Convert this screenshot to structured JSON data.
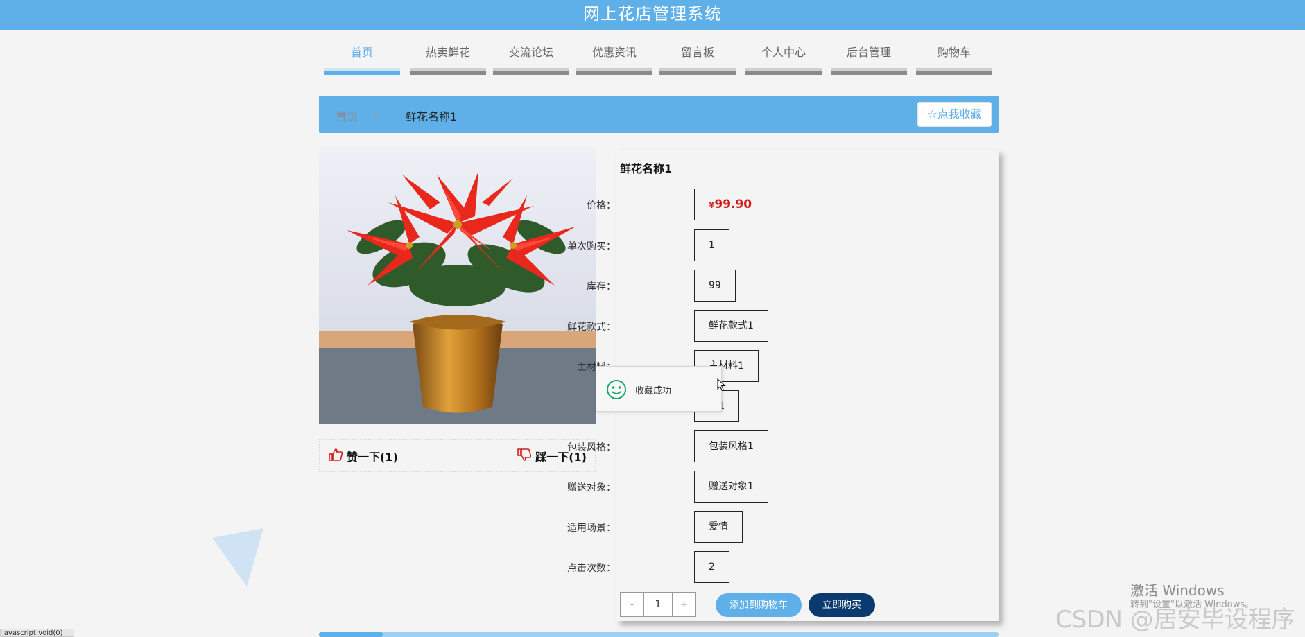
{
  "app": {
    "title": "网上花店管理系统"
  },
  "nav": [
    {
      "label": "首页",
      "active": true
    },
    {
      "label": "热卖鲜花"
    },
    {
      "label": "交流论坛"
    },
    {
      "label": "优惠资讯"
    },
    {
      "label": "留言板"
    },
    {
      "label": "个人中心"
    },
    {
      "label": "后台管理"
    },
    {
      "label": "购物车"
    }
  ],
  "breadcrumb": {
    "home": "首页",
    "separator": "/",
    "current": "鲜花名称1",
    "favorite_button": "☆点我收藏"
  },
  "product": {
    "name": "鲜花名称1",
    "price": {
      "label": "价格：",
      "currency": "¥",
      "value": "99.90"
    },
    "fields": [
      {
        "label": "单次购买：",
        "value": "1"
      },
      {
        "label": "库存：",
        "value": "99"
      },
      {
        "label": "鲜花款式：",
        "value": "鲜花款式1"
      },
      {
        "label": "主材料：",
        "value": "主材料1"
      },
      {
        "label": "",
        "value": "语1"
      },
      {
        "label": "包装风格：",
        "value": "包装风格1"
      },
      {
        "label": "赠送对象：",
        "value": "赠送对象1"
      },
      {
        "label": "适用场景：",
        "value": "爱情"
      },
      {
        "label": "点击次数：",
        "value": "2"
      }
    ]
  },
  "vote": {
    "like": "赞一下(1)",
    "dislike": "踩一下(1)"
  },
  "quantity": {
    "minus": "-",
    "value": "1",
    "plus": "+"
  },
  "actions": {
    "add_to_cart": "添加到购物车",
    "buy_now": "立即购买"
  },
  "toast": {
    "message": "收藏成功"
  },
  "status_bar": {
    "text": "javascript:void(0)"
  },
  "watermark": {
    "windows_title": "激活 Windows",
    "windows_sub": "转到\"设置\"以激活 Windows。",
    "csdn": "CSDN @居安毕设程序"
  },
  "colors": {
    "primary": "#5fb0e8",
    "dark_button": "#0b3a6e",
    "price": "#d21b1b",
    "success": "#1aa36a"
  }
}
